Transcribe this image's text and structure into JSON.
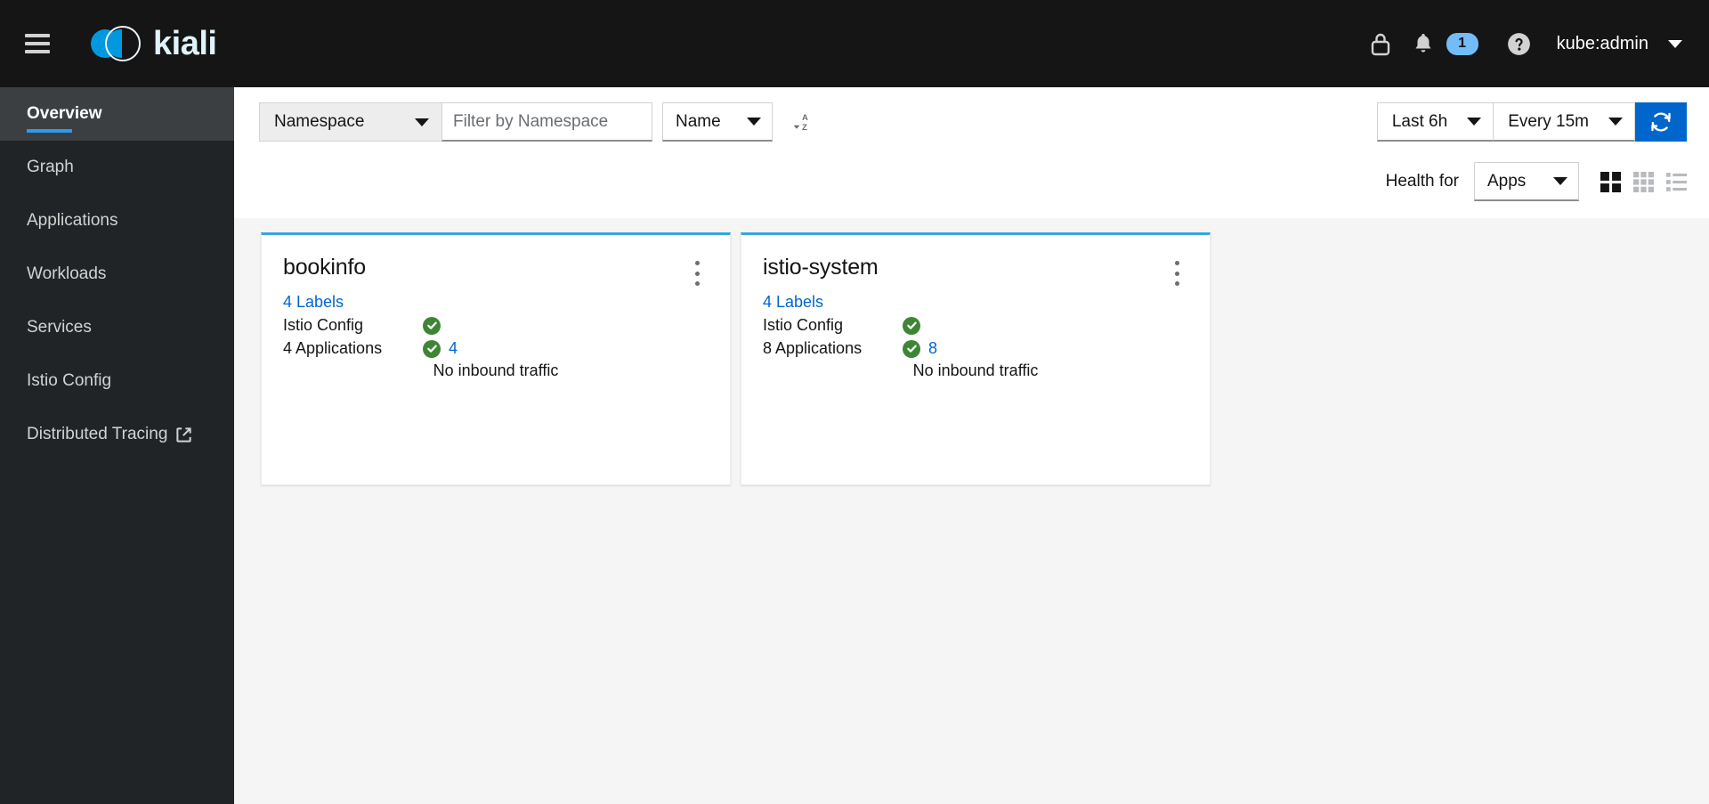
{
  "masthead": {
    "menu_icon": "hamburger-icon",
    "brand": "kiali",
    "lock_icon": "lock-icon",
    "bell_icon": "bell-icon",
    "notification_count": "1",
    "help_icon": "help-circle-icon",
    "user": "kube:admin",
    "user_caret_icon": "chevron-down-icon"
  },
  "sidebar": {
    "items": [
      {
        "label": "Overview",
        "active": true,
        "external": false
      },
      {
        "label": "Graph",
        "active": false,
        "external": false
      },
      {
        "label": "Applications",
        "active": false,
        "external": false
      },
      {
        "label": "Workloads",
        "active": false,
        "external": false
      },
      {
        "label": "Services",
        "active": false,
        "external": false
      },
      {
        "label": "Istio Config",
        "active": false,
        "external": false
      },
      {
        "label": "Distributed Tracing",
        "active": false,
        "external": true
      }
    ]
  },
  "toolbar": {
    "namespace_select": "Namespace",
    "namespace_filter_placeholder": "Filter by Namespace",
    "namespace_filter_value": "",
    "sort_select": "Name",
    "sort_direction_icon": "sort-alpha-ascending-icon",
    "time_range": "Last 6h",
    "refresh_interval": "Every 15m",
    "refresh_icon": "refresh-icon",
    "health_for_label": "Health for",
    "health_for_value": "Apps",
    "view_modes": [
      {
        "name": "expand-view-icon",
        "active": true
      },
      {
        "name": "compact-view-icon",
        "active": false
      },
      {
        "name": "list-view-icon",
        "active": false
      }
    ]
  },
  "cards": [
    {
      "title": "bookinfo",
      "labels_link": "4 Labels",
      "istio_config_label": "Istio Config",
      "istio_config_status": "healthy",
      "applications_label": "4 Applications",
      "applications_status": "healthy",
      "applications_count": "4",
      "traffic_message": "No inbound traffic",
      "menu_icon": "kebab-menu-icon"
    },
    {
      "title": "istio-system",
      "labels_link": "4 Labels",
      "istio_config_label": "Istio Config",
      "istio_config_status": "healthy",
      "applications_label": "8 Applications",
      "applications_status": "healthy",
      "applications_count": "8",
      "traffic_message": "No inbound traffic",
      "menu_icon": "kebab-menu-icon"
    }
  ],
  "colors": {
    "masthead_bg": "#151515",
    "sidebar_bg": "#212427",
    "sidebar_active_bg": "#3c3f42",
    "accent_blue": "#2b9af3",
    "link_blue": "#0066cc",
    "brand_blue": "#0099e0",
    "card_top_border": "#39a5dc",
    "health_green": "#3e8635",
    "primary_button": "#0066cc",
    "badge_blue": "#73bcf7",
    "content_bg": "#f5f5f5"
  }
}
